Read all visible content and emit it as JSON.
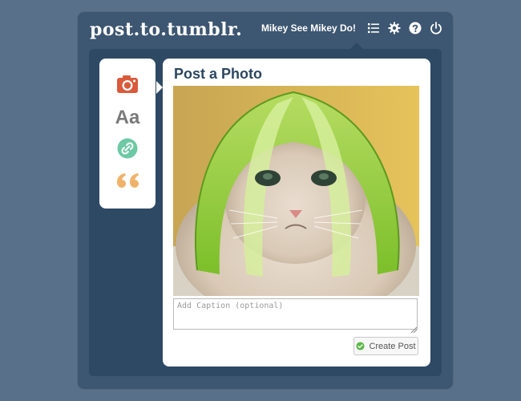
{
  "app": {
    "logo_text": "post.to.tumblr.",
    "username": "Mikey See Mikey Do!",
    "header_icons": [
      "list-icon",
      "gear-icon",
      "help-icon",
      "power-icon"
    ]
  },
  "post_types": [
    {
      "name": "photo",
      "icon": "camera-icon",
      "color": "#d95b3b"
    },
    {
      "name": "text",
      "icon": "text-icon",
      "label": "Aa",
      "color": "#7a7a7a"
    },
    {
      "name": "link",
      "icon": "link-icon",
      "color": "#6cc9a3"
    },
    {
      "name": "quote",
      "icon": "quote-icon",
      "color": "#f0b26a"
    }
  ],
  "post": {
    "title": "Post a Photo",
    "caption_placeholder": "Add Caption (optional)",
    "caption_value": "",
    "create_label": "Create Post"
  },
  "colors": {
    "background": "#587089",
    "outer_panel": "#3d5671",
    "inner_panel": "#2e4964",
    "title": "#2c4660",
    "check_green": "#5cb848"
  }
}
